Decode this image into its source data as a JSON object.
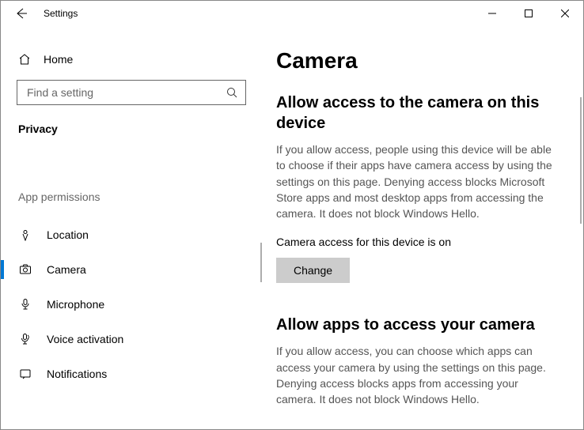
{
  "titlebar": {
    "title": "Settings"
  },
  "sidebar": {
    "home_label": "Home",
    "search_placeholder": "Find a setting",
    "section_title": "Privacy",
    "group_label": "App permissions",
    "items": [
      {
        "icon": "location",
        "label": "Location"
      },
      {
        "icon": "camera",
        "label": "Camera"
      },
      {
        "icon": "microphone",
        "label": "Microphone"
      },
      {
        "icon": "voice",
        "label": "Voice activation"
      },
      {
        "icon": "notifications",
        "label": "Notifications"
      }
    ]
  },
  "main": {
    "page_title": "Camera",
    "section1": {
      "heading": "Allow access to the camera on this device",
      "body": "If you allow access, people using this device will be able to choose if their apps have camera access by using the settings on this page. Denying access blocks Microsoft Store apps and most desktop apps from accessing the camera. It does not block Windows Hello.",
      "status": "Camera access for this device is on",
      "change_label": "Change"
    },
    "section2": {
      "heading": "Allow apps to access your camera",
      "body": "If you allow access, you can choose which apps can access your camera by using the settings on this page. Denying access blocks apps from accessing your camera. It does not block Windows Hello."
    }
  }
}
